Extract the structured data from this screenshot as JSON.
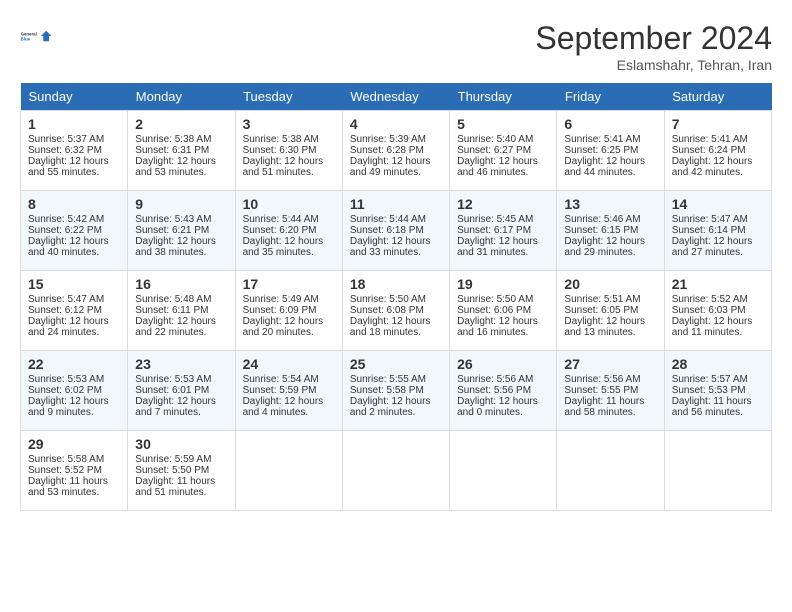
{
  "header": {
    "logo_line1": "General",
    "logo_line2": "Blue",
    "month": "September 2024",
    "location": "Eslamshahr, Tehran, Iran"
  },
  "weekdays": [
    "Sunday",
    "Monday",
    "Tuesday",
    "Wednesday",
    "Thursday",
    "Friday",
    "Saturday"
  ],
  "weeks": [
    [
      {
        "day": "1",
        "sunrise": "5:37 AM",
        "sunset": "6:32 PM",
        "daylight": "12 hours and 55 minutes."
      },
      {
        "day": "2",
        "sunrise": "5:38 AM",
        "sunset": "6:31 PM",
        "daylight": "12 hours and 53 minutes."
      },
      {
        "day": "3",
        "sunrise": "5:38 AM",
        "sunset": "6:30 PM",
        "daylight": "12 hours and 51 minutes."
      },
      {
        "day": "4",
        "sunrise": "5:39 AM",
        "sunset": "6:28 PM",
        "daylight": "12 hours and 49 minutes."
      },
      {
        "day": "5",
        "sunrise": "5:40 AM",
        "sunset": "6:27 PM",
        "daylight": "12 hours and 46 minutes."
      },
      {
        "day": "6",
        "sunrise": "5:41 AM",
        "sunset": "6:25 PM",
        "daylight": "12 hours and 44 minutes."
      },
      {
        "day": "7",
        "sunrise": "5:41 AM",
        "sunset": "6:24 PM",
        "daylight": "12 hours and 42 minutes."
      }
    ],
    [
      {
        "day": "8",
        "sunrise": "5:42 AM",
        "sunset": "6:22 PM",
        "daylight": "12 hours and 40 minutes."
      },
      {
        "day": "9",
        "sunrise": "5:43 AM",
        "sunset": "6:21 PM",
        "daylight": "12 hours and 38 minutes."
      },
      {
        "day": "10",
        "sunrise": "5:44 AM",
        "sunset": "6:20 PM",
        "daylight": "12 hours and 35 minutes."
      },
      {
        "day": "11",
        "sunrise": "5:44 AM",
        "sunset": "6:18 PM",
        "daylight": "12 hours and 33 minutes."
      },
      {
        "day": "12",
        "sunrise": "5:45 AM",
        "sunset": "6:17 PM",
        "daylight": "12 hours and 31 minutes."
      },
      {
        "day": "13",
        "sunrise": "5:46 AM",
        "sunset": "6:15 PM",
        "daylight": "12 hours and 29 minutes."
      },
      {
        "day": "14",
        "sunrise": "5:47 AM",
        "sunset": "6:14 PM",
        "daylight": "12 hours and 27 minutes."
      }
    ],
    [
      {
        "day": "15",
        "sunrise": "5:47 AM",
        "sunset": "6:12 PM",
        "daylight": "12 hours and 24 minutes."
      },
      {
        "day": "16",
        "sunrise": "5:48 AM",
        "sunset": "6:11 PM",
        "daylight": "12 hours and 22 minutes."
      },
      {
        "day": "17",
        "sunrise": "5:49 AM",
        "sunset": "6:09 PM",
        "daylight": "12 hours and 20 minutes."
      },
      {
        "day": "18",
        "sunrise": "5:50 AM",
        "sunset": "6:08 PM",
        "daylight": "12 hours and 18 minutes."
      },
      {
        "day": "19",
        "sunrise": "5:50 AM",
        "sunset": "6:06 PM",
        "daylight": "12 hours and 16 minutes."
      },
      {
        "day": "20",
        "sunrise": "5:51 AM",
        "sunset": "6:05 PM",
        "daylight": "12 hours and 13 minutes."
      },
      {
        "day": "21",
        "sunrise": "5:52 AM",
        "sunset": "6:03 PM",
        "daylight": "12 hours and 11 minutes."
      }
    ],
    [
      {
        "day": "22",
        "sunrise": "5:53 AM",
        "sunset": "6:02 PM",
        "daylight": "12 hours and 9 minutes."
      },
      {
        "day": "23",
        "sunrise": "5:53 AM",
        "sunset": "6:01 PM",
        "daylight": "12 hours and 7 minutes."
      },
      {
        "day": "24",
        "sunrise": "5:54 AM",
        "sunset": "5:59 PM",
        "daylight": "12 hours and 4 minutes."
      },
      {
        "day": "25",
        "sunrise": "5:55 AM",
        "sunset": "5:58 PM",
        "daylight": "12 hours and 2 minutes."
      },
      {
        "day": "26",
        "sunrise": "5:56 AM",
        "sunset": "5:56 PM",
        "daylight": "12 hours and 0 minutes."
      },
      {
        "day": "27",
        "sunrise": "5:56 AM",
        "sunset": "5:55 PM",
        "daylight": "11 hours and 58 minutes."
      },
      {
        "day": "28",
        "sunrise": "5:57 AM",
        "sunset": "5:53 PM",
        "daylight": "11 hours and 56 minutes."
      }
    ],
    [
      {
        "day": "29",
        "sunrise": "5:58 AM",
        "sunset": "5:52 PM",
        "daylight": "11 hours and 53 minutes."
      },
      {
        "day": "30",
        "sunrise": "5:59 AM",
        "sunset": "5:50 PM",
        "daylight": "11 hours and 51 minutes."
      },
      null,
      null,
      null,
      null,
      null
    ]
  ]
}
